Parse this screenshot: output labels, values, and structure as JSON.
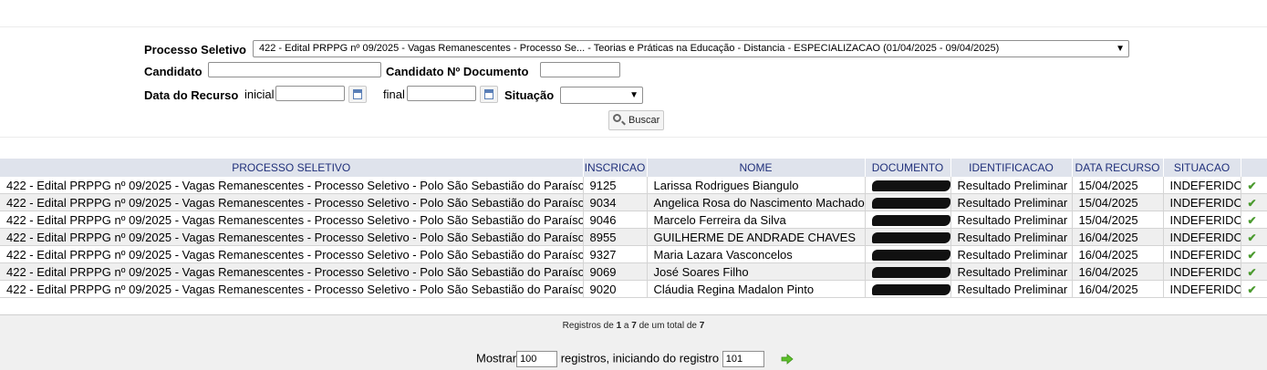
{
  "filters": {
    "processo_label": "Processo Seletivo",
    "processo_value": "422 - Edital PRPPG nº 09/2025 - Vagas Remanescentes - Processo Se... - Teorias e Práticas na Educação - Distancia - ESPECIALIZACAO (01/04/2025 - 09/04/2025)",
    "candidato_label": "Candidato",
    "candidato_value": "",
    "documento_label": "Candidato Nº Documento",
    "documento_value": "",
    "data_label": "Data do Recurso",
    "inicial_label": "inicial",
    "inicial_value": "",
    "final_label": "final",
    "final_value": "",
    "situacao_label": "Situação",
    "situacao_value": "",
    "buscar_label": "Buscar"
  },
  "table": {
    "headers": [
      "PROCESSO SELETIVO",
      "INSCRICAO",
      "NOME",
      "DOCUMENTO",
      "IDENTIFICACAO",
      "DATA RECURSO",
      "SITUACAO"
    ],
    "rows": [
      {
        "processo": "422 - Edital PRPPG nº 09/2025 - Vagas Remanescentes - Processo Seletivo - Polo São Sebastião do Paraíso",
        "inscricao": "9125",
        "nome": "Larissa Rodrigues Biangulo",
        "identificacao": "Resultado Preliminar",
        "data": "15/04/2025",
        "situacao": "INDEFERIDO"
      },
      {
        "processo": "422 - Edital PRPPG nº 09/2025 - Vagas Remanescentes - Processo Seletivo - Polo São Sebastião do Paraíso",
        "inscricao": "9034",
        "nome": "Angelica Rosa do Nascimento Machado",
        "identificacao": "Resultado Preliminar",
        "data": "15/04/2025",
        "situacao": "INDEFERIDO"
      },
      {
        "processo": "422 - Edital PRPPG nº 09/2025 - Vagas Remanescentes - Processo Seletivo - Polo São Sebastião do Paraíso",
        "inscricao": "9046",
        "nome": "Marcelo Ferreira da Silva",
        "identificacao": "Resultado Preliminar",
        "data": "15/04/2025",
        "situacao": "INDEFERIDO"
      },
      {
        "processo": "422 - Edital PRPPG nº 09/2025 - Vagas Remanescentes - Processo Seletivo - Polo São Sebastião do Paraíso",
        "inscricao": "8955",
        "nome": "GUILHERME DE ANDRADE CHAVES",
        "identificacao": "Resultado Preliminar",
        "data": "16/04/2025",
        "situacao": "INDEFERIDO"
      },
      {
        "processo": "422 - Edital PRPPG nº 09/2025 - Vagas Remanescentes - Processo Seletivo - Polo São Sebastião do Paraíso",
        "inscricao": "9327",
        "nome": "Maria Lazara Vasconcelos",
        "identificacao": "Resultado Preliminar",
        "data": "16/04/2025",
        "situacao": "INDEFERIDO"
      },
      {
        "processo": "422 - Edital PRPPG nº 09/2025 - Vagas Remanescentes - Processo Seletivo - Polo São Sebastião do Paraíso",
        "inscricao": "9069",
        "nome": "José Soares Filho",
        "identificacao": "Resultado Preliminar",
        "data": "16/04/2025",
        "situacao": "INDEFERIDO"
      },
      {
        "processo": "422 - Edital PRPPG nº 09/2025 - Vagas Remanescentes - Processo Seletivo - Polo São Sebastião do Paraíso",
        "inscricao": "9020",
        "nome": "Cláudia Regina Madalon Pinto",
        "identificacao": "Resultado Preliminar",
        "data": "16/04/2025",
        "situacao": "INDEFERIDO"
      }
    ]
  },
  "footer": {
    "reg_prefix": "Registros de",
    "reg_from": "1",
    "reg_a": "a",
    "reg_to": "7",
    "reg_mid": "de um total de",
    "reg_total": "7",
    "mostrar_label": "Mostrar",
    "mostrar_value": "100",
    "iniciando_label": "registros, iniciando do registro",
    "iniciando_value": "101"
  },
  "icons": {
    "calendar": "calendar-icon",
    "search": "magnifier-icon",
    "check": "check-icon",
    "go": "green-arrow-icon"
  },
  "colors": {
    "header_text": "#1f2f7a",
    "header_bg": "#dfe3ec",
    "check": "#4a9a2e",
    "go": "#5cc02a"
  }
}
